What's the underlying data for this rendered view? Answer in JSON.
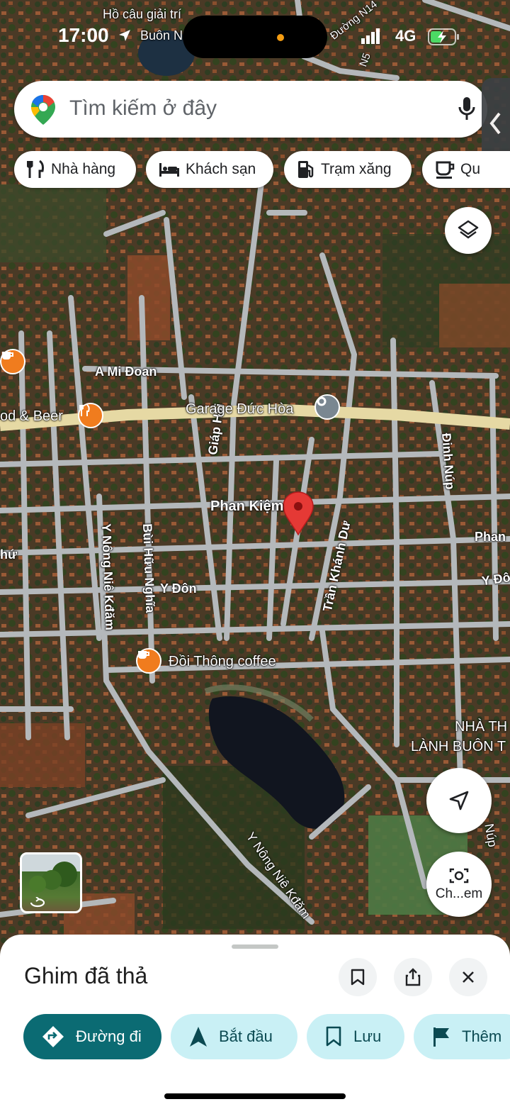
{
  "status_bar": {
    "time": "17:00",
    "network": "4G"
  },
  "search": {
    "placeholder": "Tìm kiếm ở đây"
  },
  "chips": [
    {
      "label": "Nhà hàng",
      "icon": "restaurant-icon"
    },
    {
      "label": "Khách sạn",
      "icon": "bed-icon"
    },
    {
      "label": "Trạm xăng",
      "icon": "gas-station-icon"
    },
    {
      "label": "Qu",
      "icon": "coffee-icon"
    }
  ],
  "map": {
    "top_labels": {
      "pond": "Hồ câu giải trí",
      "place": "Buôn N",
      "street_top": "Đường N14",
      "n5": "N5"
    },
    "streets": {
      "a_mi_doan": "A Mi Đoan",
      "giap_hai": "Giáp Hải",
      "phan_kiem": "Phan Kiệm",
      "y_nong": "Y Nông Niê Kđăm",
      "bui_huu_nghia": "Bùi Hữu Nghĩa",
      "y_don": "Y Đôn",
      "tran_khanh_du": "Trần Khánh Dư",
      "dinh_nup": "Đinh Núp",
      "phan_right": "Phan",
      "y_don_right": "Y Đôn",
      "y_nong_lower": "Y Nông Niê Kđăm",
      "nup": "Núp",
      "chu": "hứ"
    },
    "pois": {
      "food_beer": "od & Beer",
      "garage": "Garage Đức Hòa",
      "doi_thong": "Đồi Thông coffee",
      "school_line1": "NHÀ TH",
      "school_line2": "LÀNH BUÔN T"
    },
    "pin_color": "#e53935"
  },
  "controls": {
    "layers": "layers-icon",
    "locate": "navigation-arrow-icon",
    "lens_label": "Ch...em"
  },
  "sheet": {
    "title": "Ghim đã thả",
    "actions": [
      {
        "label": "Đường đi",
        "icon": "directions-icon"
      },
      {
        "label": "Bắt đầu",
        "icon": "navigation-icon"
      },
      {
        "label": "Lưu",
        "icon": "bookmark-icon"
      },
      {
        "label": "Thêm",
        "icon": "flag-icon"
      }
    ]
  },
  "colors": {
    "primary": "#0b6b73",
    "secondary_bg": "#c9f0f5",
    "road": "#b9bcbf",
    "main_road": "#e6d9a4"
  }
}
